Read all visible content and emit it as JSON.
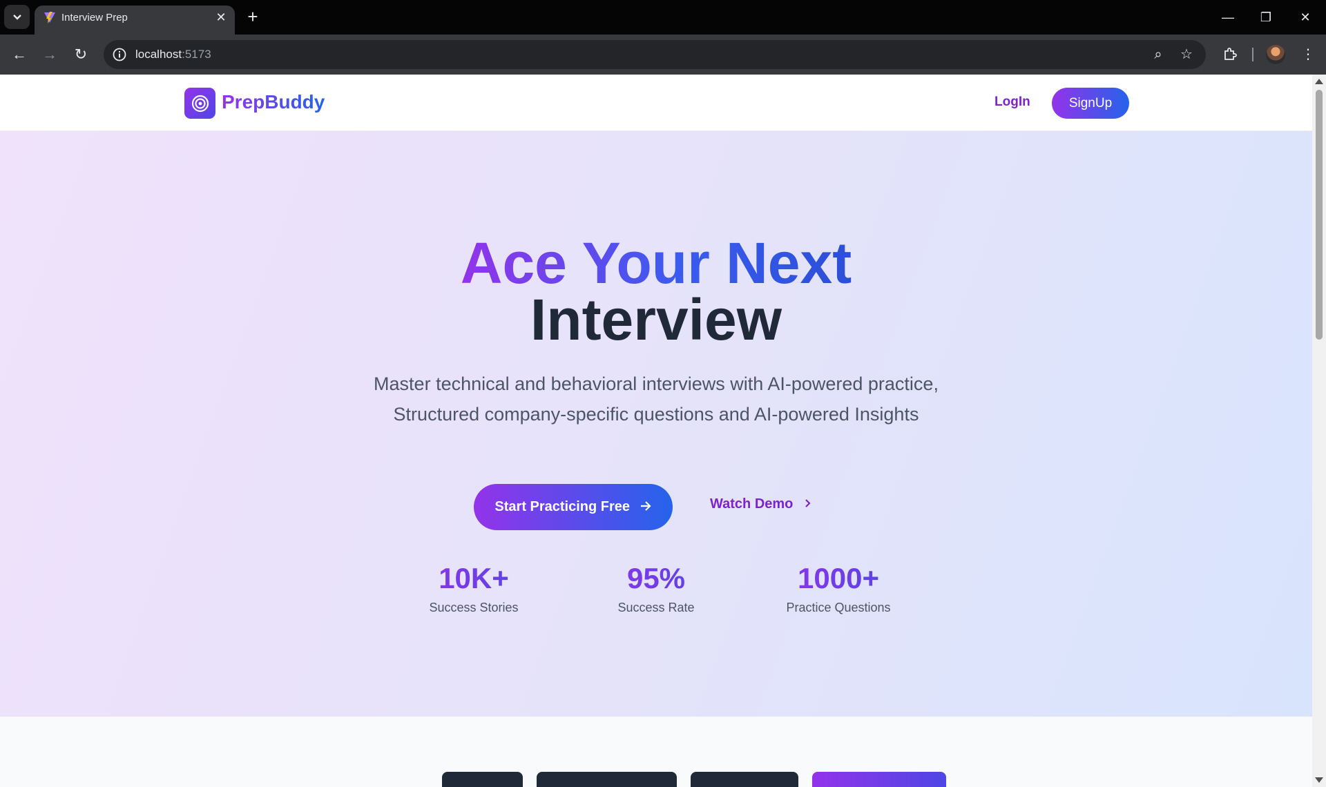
{
  "browser": {
    "tab_title": "Interview Prep",
    "url_host": "localhost",
    "url_port": ":5173"
  },
  "navbar": {
    "brand": "PrepBuddy",
    "login_label": "LogIn",
    "signup_label": "SignUp"
  },
  "hero": {
    "headline_part1": "Ace Your Next",
    "headline_part2": "Interview",
    "subtitle_line1": "Master technical and behavioral interviews with AI-powered practice,",
    "subtitle_line2": "Structured company-specific questions and AI-powered Insights",
    "cta_label": "Start Practicing Free",
    "demo_label": "Watch Demo",
    "stats": [
      {
        "value": "10K+",
        "label": "Success Stories"
      },
      {
        "value": "95%",
        "label": "Success Rate"
      },
      {
        "value": "1000+",
        "label": "Practice Questions"
      }
    ]
  },
  "colors": {
    "brand_purple": "#9333ea",
    "brand_blue": "#2563eb",
    "heading_dark": "#1f2937"
  }
}
